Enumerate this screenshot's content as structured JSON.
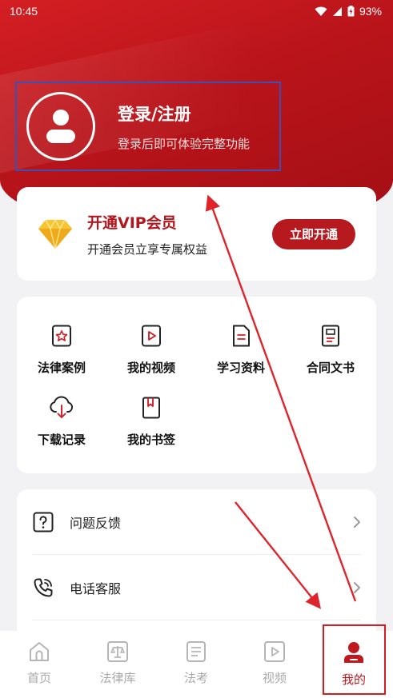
{
  "status_bar": {
    "time": "10:45",
    "battery": "93%"
  },
  "profile": {
    "title": "登录/注册",
    "subtitle": "登录后即可体验完整功能"
  },
  "vip": {
    "title": "开通VIP会员",
    "subtitle": "开通会员立享专属权益",
    "button": "立即开通"
  },
  "features": [
    {
      "label": "法律案例",
      "icon": "star-document-icon"
    },
    {
      "label": "我的视频",
      "icon": "video-icon"
    },
    {
      "label": "学习资料",
      "icon": "document-icon"
    },
    {
      "label": "合同文书",
      "icon": "contract-icon"
    },
    {
      "label": "下载记录",
      "icon": "cloud-download-icon"
    },
    {
      "label": "我的书签",
      "icon": "bookmark-icon"
    }
  ],
  "list": [
    {
      "label": "问题反馈",
      "icon": "question-icon"
    },
    {
      "label": "电话客服",
      "icon": "phone-icon"
    }
  ],
  "tabs": [
    {
      "label": "首页",
      "icon": "home-icon"
    },
    {
      "label": "法律库",
      "icon": "law-library-icon"
    },
    {
      "label": "法考",
      "icon": "exam-icon"
    },
    {
      "label": "视频",
      "icon": "video-tab-icon"
    },
    {
      "label": "我的",
      "icon": "profile-icon",
      "active": true
    }
  ],
  "colors": {
    "primary": "#b61a1f",
    "annotation_arrow": "#e0242b",
    "highlight_box": "#3b50b8"
  }
}
